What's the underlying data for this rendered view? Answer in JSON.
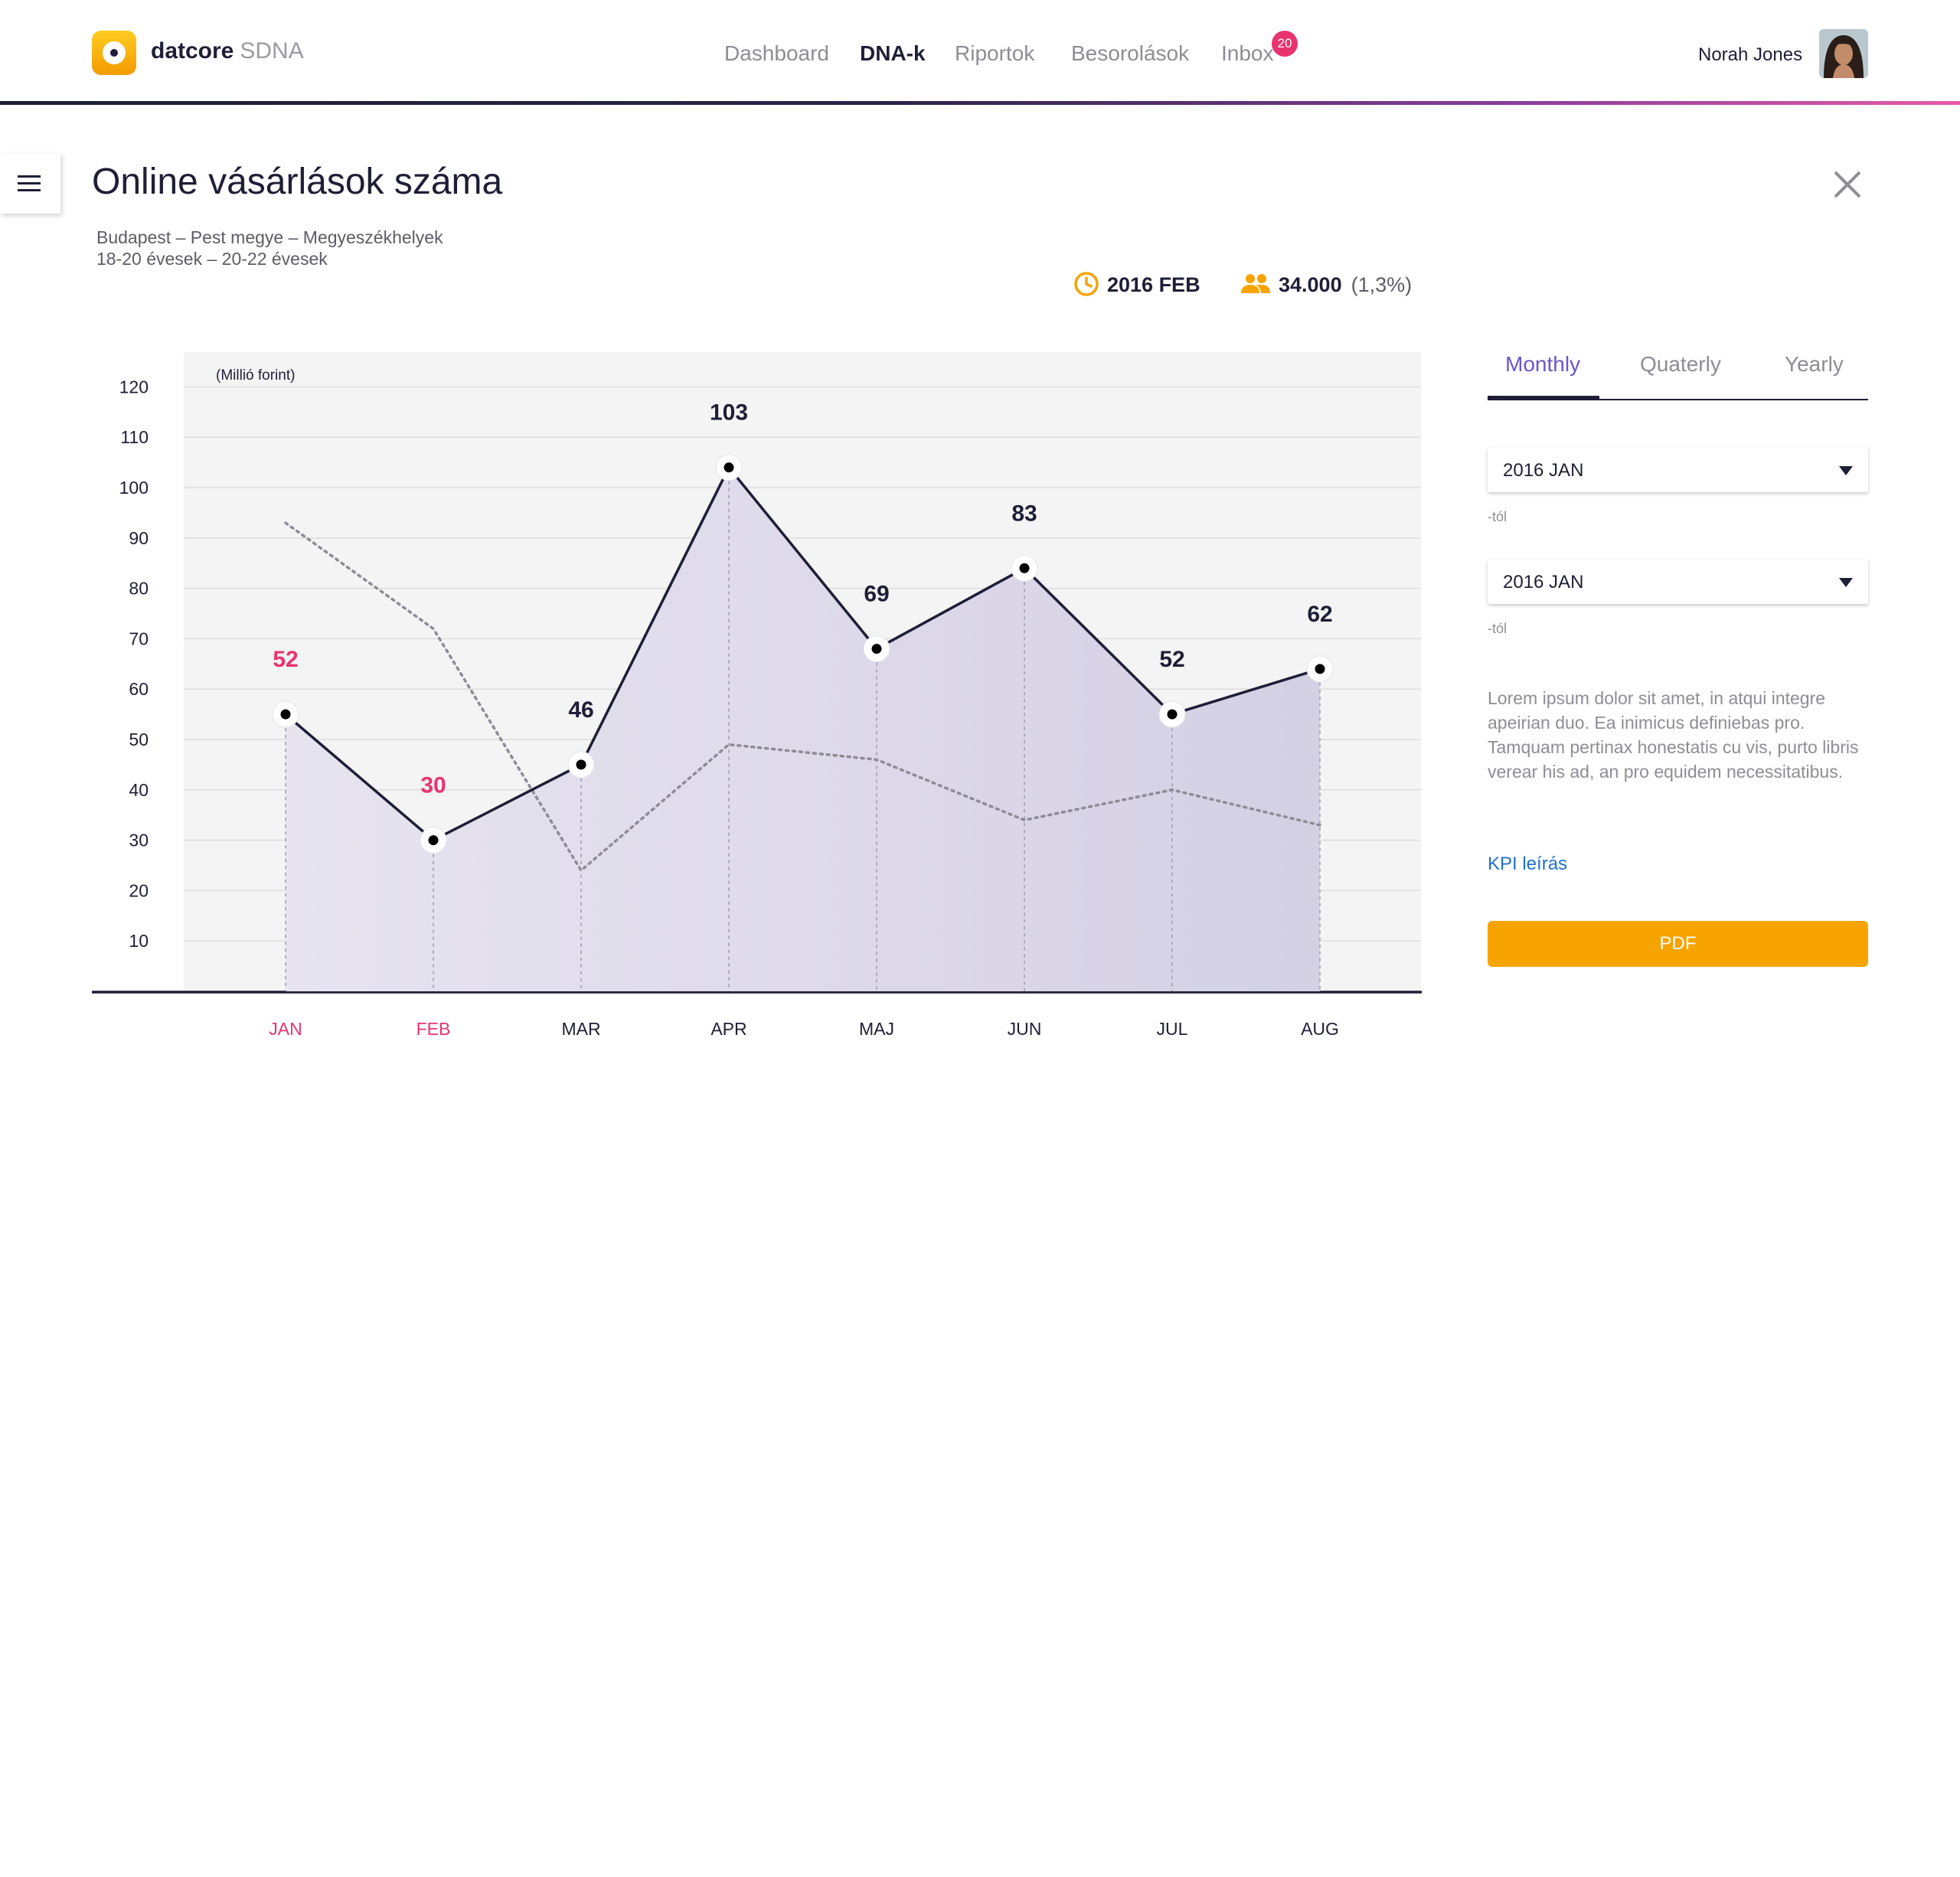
{
  "app": {
    "brand_name": "datcore",
    "brand_product": "SDNA",
    "nav": [
      {
        "label": "Dashboard"
      },
      {
        "label": "DNA-k"
      },
      {
        "label": "Riportok"
      },
      {
        "label": "Besorolások"
      },
      {
        "label": "Inbox"
      }
    ],
    "active_nav": "DNA-k",
    "inbox_badge": "20",
    "user_name": "Norah Jones"
  },
  "page": {
    "title": "Online vásárlások száma",
    "filters_line1": "Budapest – Pest megye – Megyeszékhelyek",
    "filters_line2": "18-20 évesek – 20-22 évesek",
    "period": "2016 FEB",
    "users_count": "34.000",
    "users_pct": "(1,3%)"
  },
  "panel": {
    "tabs": [
      {
        "label": "Monthly"
      },
      {
        "label": "Quaterly"
      },
      {
        "label": "Yearly"
      }
    ],
    "active_tab": "Monthly",
    "from_select": {
      "value": "2016 JAN",
      "caption": "-tól"
    },
    "to_select": {
      "value": "2016 JAN",
      "caption": "-tól"
    },
    "description": "Lorem ipsum dolor sit amet, in atqui integre apeirian duo. Ea inimicus definiebas pro. Tamquam pertinax honestatis cu vis, purto libris verear his ad, an pro equidem necessitatibus.",
    "kpi_link": "KPI leírás",
    "pdf_label": "PDF"
  },
  "colors": {
    "accent_orange": "#f7a300",
    "highlight_pink": "#e8336e",
    "dark_navy": "#1e1f36",
    "tab_active_purple": "#6a55c8",
    "area_fill": "#d4d0e4",
    "link_blue": "#1e6fd0"
  },
  "icons": {
    "menu": "hamburger-icon",
    "close": "close-icon",
    "period": "clock-icon",
    "users": "people-icon",
    "dropdown": "caret-down-icon"
  },
  "chart_data": {
    "type": "line",
    "unit_label": "(Millió forint)",
    "categories": [
      "JAN",
      "FEB",
      "MAR",
      "APR",
      "MAJ",
      "JUN",
      "JUL",
      "AUG"
    ],
    "highlighted_categories": [
      "JAN",
      "FEB"
    ],
    "ylim": [
      0,
      120
    ],
    "yticks": [
      10,
      20,
      30,
      40,
      50,
      60,
      70,
      80,
      90,
      100,
      110,
      120
    ],
    "grid": true,
    "series": [
      {
        "values": [
          55,
          30,
          45,
          104,
          68,
          84,
          55,
          64
        ],
        "labels": [
          "52",
          "30",
          "46",
          "103",
          "69",
          "83",
          "52",
          "62"
        ],
        "style": "solid-area"
      },
      {
        "values": [
          93,
          72,
          24,
          49,
          46,
          34,
          40,
          33
        ],
        "style": "dotted"
      }
    ]
  }
}
